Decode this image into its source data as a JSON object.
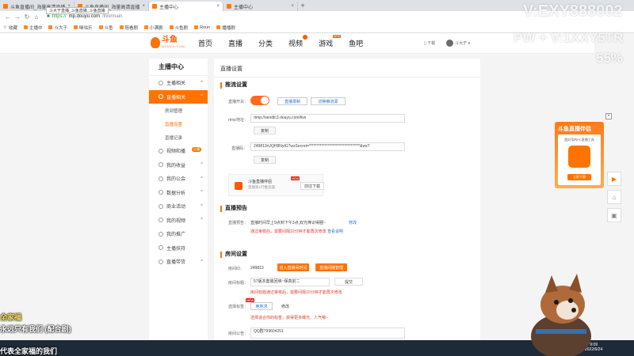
{
  "browser": {
    "tabs": [
      {
        "label": "斗鱼直播间_海量高清直播"
      },
      {
        "label": "斗鱼直播间_海量高清直播"
      },
      {
        "label": "主播中心",
        "active": true
      },
      {
        "label": "主播中心"
      }
    ],
    "tab_tooltip": "斗大于直播_斗鱼直播_斗鱼直播",
    "new_tab": "+",
    "url": {
      "scheme": "https://",
      "host": "mp.douyu.com",
      "path": "/live/main"
    },
    "bookmarks": [
      "收藏",
      "主播中",
      "斗大于",
      "咪咕乐",
      "斗鱼",
      "陪看剧",
      "小满剧",
      "斗鱼剧",
      "Roun",
      "播播剧"
    ]
  },
  "site": {
    "logo_text": "斗鱼",
    "logo_sub": "DOUYU.COM",
    "nav": [
      "首页",
      "直播",
      "分类",
      "视频",
      "游戏",
      "鱼吧"
    ],
    "nav_new_label": "NEW",
    "header_right": {
      "download": "下载",
      "username": "斗大于"
    }
  },
  "sidebar": {
    "title": "主播中心",
    "items": [
      {
        "label": "主播相关"
      },
      {
        "label": "直播相关",
        "active": true
      },
      {
        "label": "房间管理",
        "sub": true
      },
      {
        "label": "直播设置",
        "sub": true,
        "current": true
      },
      {
        "label": "直播记录",
        "sub": true
      },
      {
        "label": "视频和播",
        "tag": "火爆"
      },
      {
        "label": "我的收益"
      },
      {
        "label": "我的公会"
      },
      {
        "label": "数据分析"
      },
      {
        "label": "商业活动"
      },
      {
        "label": "我的视频"
      },
      {
        "label": "我的推广"
      },
      {
        "label": "主播扶持"
      },
      {
        "label": "直播带货"
      }
    ]
  },
  "main": {
    "title": "直播设置",
    "stream": {
      "section": "推流设置",
      "switch_label": "直播开关：",
      "btn_record": "直播录制",
      "btn_switch": "切换推流源",
      "rtmp_label": "rtmp地址：",
      "rtmp_value": "rtmp://sendtc3.douyu.com/live",
      "copy": "复制",
      "code_label": "直播码：",
      "code_value": "249813rUQH8NytG?wsSecret=*********************************&wsT",
      "copy2": "复制",
      "assistant_title": "斗鱼直播伴侣",
      "assistant_desc": "直播第1行推流器",
      "assistant_new": "NEW",
      "assistant_download": "前往下载"
    },
    "preview": {
      "section": "直播预告",
      "label": "直播预告：",
      "text": "直播时间早上9点到下午3点,双光棒识得圈~",
      "edit": "修改",
      "notice": "通过审核后，需要间隔10分钟才能再次修改",
      "link": "查看说明"
    },
    "room": {
      "section": "房间设置",
      "id_label": "房间ID：",
      "id_value": "249813",
      "btn_enter": "进入直播间时间",
      "btn_manage": "直播间播管理",
      "title_label": "房间标题：",
      "title_value": "57版本套装回峡~保真前二",
      "submit": "提交",
      "title_notice": "房间标题通过审核后，需要间隔10分钟才能再次修改",
      "tag_label": "选择标签：",
      "tag_new": "NEW",
      "tag_value": "绝地求",
      "tag_edit": "修改",
      "tag_notice": "选择适合你的标签，获得更多曝光、人气哦~",
      "notice_label": "房间公告：",
      "notice_value": "QQ群799604251"
    }
  },
  "promo": {
    "title": "斗鱼直播伴侣",
    "desc": "超好用的PC直播工具",
    "button": "立即下载",
    "close": "×"
  },
  "overlays": {
    "watermark_1": "V:EXY888002",
    "watermark_2": "PW + V:1XXY5TR",
    "watermark_3": "55%",
    "bottom_line1": "全家福",
    "bottom_line2": "永远只有我们 (配合剧)",
    "bottom_line3": "代表全家福的我们",
    "clock_time": "9:09",
    "clock_date": "2022/6/24"
  }
}
